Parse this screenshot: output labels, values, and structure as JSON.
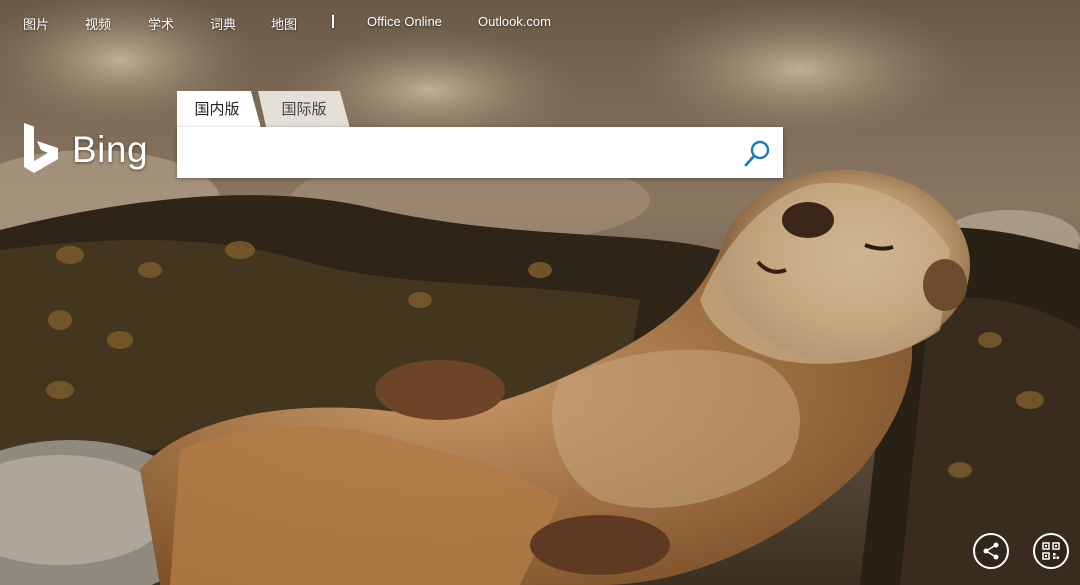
{
  "nav": {
    "items": [
      "图片",
      "视频",
      "学术",
      "词典",
      "地图"
    ],
    "separator": "|",
    "links": [
      "Office Online",
      "Outlook.com"
    ]
  },
  "logo": {
    "text": "Bing"
  },
  "scopes": {
    "domestic": "国内版",
    "international": "国际版",
    "active": "domestic"
  },
  "search": {
    "value": "",
    "placeholder": ""
  },
  "colors": {
    "search_icon": "#1a7ab6",
    "nav_text": "#ffffff"
  },
  "icons": {
    "search": "magnifier-icon",
    "share": "share-icon",
    "qr": "qr-code-icon"
  }
}
